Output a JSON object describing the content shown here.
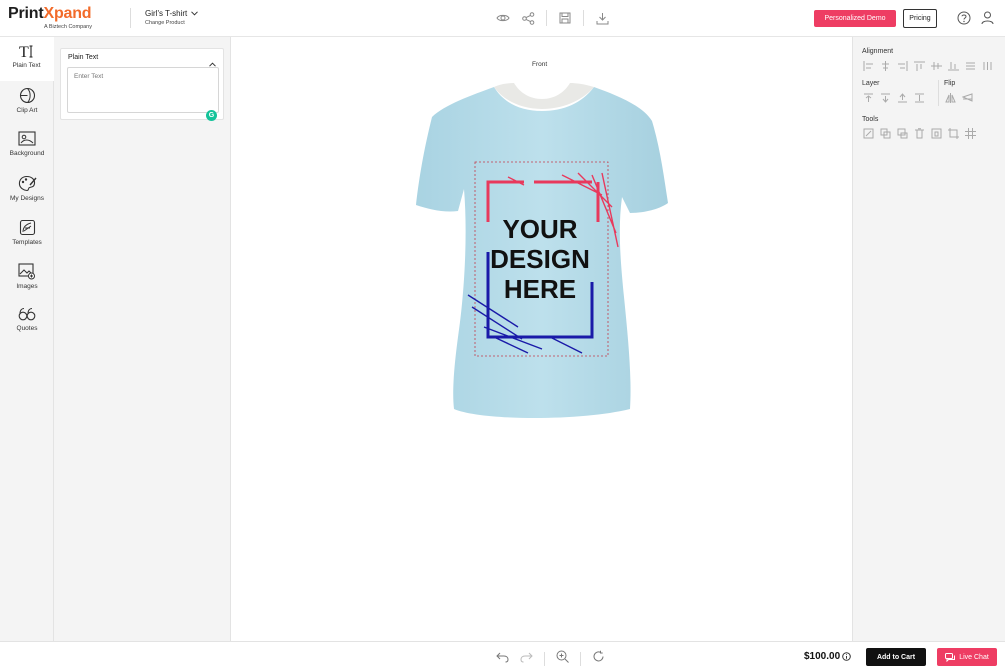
{
  "header": {
    "brand_main": "Print",
    "brand_x": "X",
    "brand_rest": "pand",
    "brand_sub": "A Biztech Company",
    "product_name": "Girl's T-shirt",
    "change_product": "Change Product",
    "demo_label": "Personalized Demo",
    "pricing_label": "Pricing",
    "icons": [
      "eye-icon",
      "share-icon",
      "save-icon",
      "download-icon",
      "help-icon",
      "user-icon"
    ]
  },
  "left_rail": {
    "items": [
      {
        "label": "Plain Text",
        "icon": "text-icon"
      },
      {
        "label": "Clip Art",
        "icon": "clipart-icon"
      },
      {
        "label": "Background",
        "icon": "background-icon"
      },
      {
        "label": "My Designs",
        "icon": "palette-icon"
      },
      {
        "label": "Templates",
        "icon": "templates-icon"
      },
      {
        "label": "Images",
        "icon": "image-icon"
      },
      {
        "label": "Quotes",
        "icon": "quotes-icon"
      }
    ]
  },
  "panel": {
    "title": "Plain Text",
    "placeholder": "Enter Text",
    "badge": "G"
  },
  "canvas": {
    "view_label": "Front",
    "design_line1": "YOUR",
    "design_line2": "DESIGN",
    "design_line3": "HERE",
    "shirt_color": "#b7dce8",
    "frame_red": "#e8395c",
    "frame_blue": "#1a1aa8"
  },
  "right_panel": {
    "alignment_title": "Alignment",
    "layer_title": "Layer",
    "flip_title": "Flip",
    "tools_title": "Tools"
  },
  "footer": {
    "price": "$100.00",
    "add_to_cart": "Add to Cart",
    "live_chat": "Live Chat"
  },
  "colors": {
    "accent": "#ee3d63",
    "brand_orange": "#f26b2a"
  }
}
